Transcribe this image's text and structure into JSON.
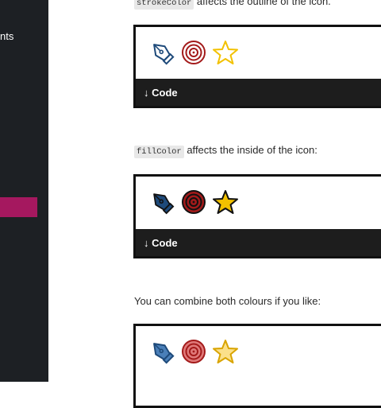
{
  "sidebar": {
    "items": [
      {
        "label": "nts"
      }
    ]
  },
  "main": {
    "paragraphs": [
      {
        "code": "strokeColor",
        "text": " affects the outline of the icon."
      },
      {
        "code": "fillColor",
        "text": " affects the inside of the icon:"
      },
      {
        "code": "",
        "text": "You can combine both colours if you like:"
      }
    ],
    "examples": [
      {
        "icons": [
          "pen-nib-icon",
          "target-icon",
          "star-icon"
        ],
        "code_label": "↓ Code"
      },
      {
        "icons": [
          "pen-nib-icon",
          "target-icon",
          "star-icon"
        ],
        "code_label": "↓ Code"
      },
      {
        "icons": [
          "pen-nib-icon",
          "target-icon",
          "star-icon"
        ],
        "code_label": ""
      }
    ]
  },
  "colors": {
    "sidebar_bg": "#1d2024",
    "sidebar_active": "#a5185f",
    "pen_blue": "#1e4a7a",
    "target_red": "#a31a1a",
    "star_yellow": "#f2c100"
  }
}
